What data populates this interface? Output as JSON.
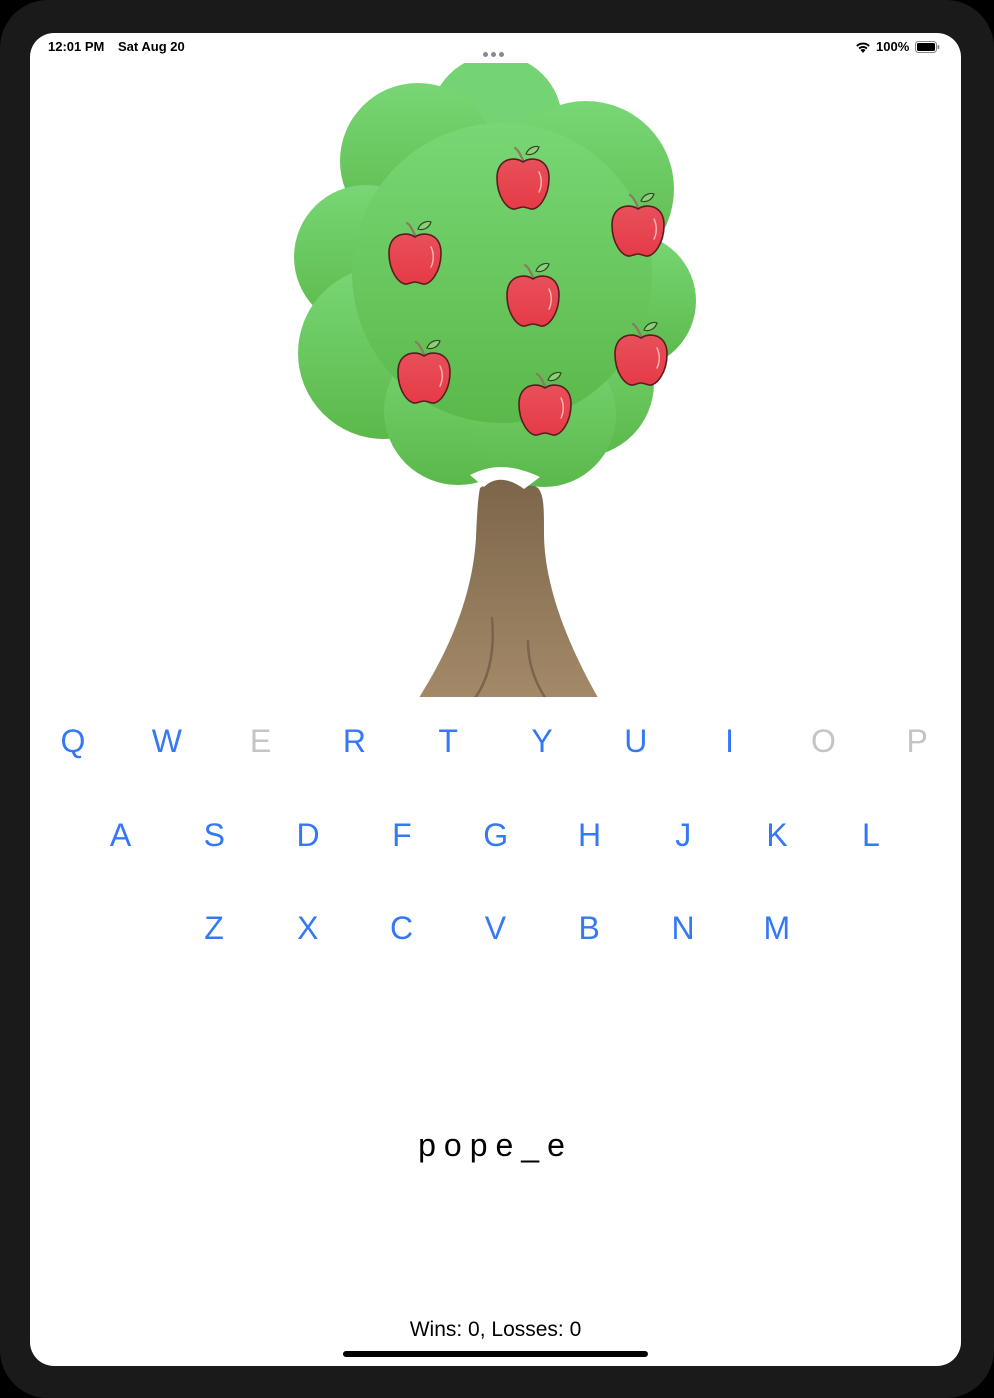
{
  "status_bar": {
    "time": "12:01 PM",
    "date": "Sat Aug 20",
    "battery_percent": "100%",
    "wifi_icon": "wifi-icon",
    "battery_icon": "battery-full-icon"
  },
  "tree": {
    "icon": "apple-tree",
    "apples_remaining": 7,
    "colors": {
      "foliage_top": "#78d775",
      "foliage_bottom": "#5bb84a",
      "trunk_top": "#7a6449",
      "trunk_bottom": "#a88e6c",
      "apple": "#e53b46"
    }
  },
  "keyboard": {
    "accent_color": "#3478f6",
    "disabled_color": "#c4c4c6",
    "rows": [
      [
        {
          "letter": "Q",
          "enabled": true
        },
        {
          "letter": "W",
          "enabled": true
        },
        {
          "letter": "E",
          "enabled": false
        },
        {
          "letter": "R",
          "enabled": true
        },
        {
          "letter": "T",
          "enabled": true
        },
        {
          "letter": "Y",
          "enabled": true
        },
        {
          "letter": "U",
          "enabled": true
        },
        {
          "letter": "I",
          "enabled": true
        },
        {
          "letter": "O",
          "enabled": false
        },
        {
          "letter": "P",
          "enabled": false
        }
      ],
      [
        {
          "letter": "A",
          "enabled": true
        },
        {
          "letter": "S",
          "enabled": true
        },
        {
          "letter": "D",
          "enabled": true
        },
        {
          "letter": "F",
          "enabled": true
        },
        {
          "letter": "G",
          "enabled": true
        },
        {
          "letter": "H",
          "enabled": true
        },
        {
          "letter": "J",
          "enabled": true
        },
        {
          "letter": "K",
          "enabled": true
        },
        {
          "letter": "L",
          "enabled": true
        }
      ],
      [
        {
          "letter": "Z",
          "enabled": true
        },
        {
          "letter": "X",
          "enabled": true
        },
        {
          "letter": "C",
          "enabled": true
        },
        {
          "letter": "V",
          "enabled": true
        },
        {
          "letter": "B",
          "enabled": true
        },
        {
          "letter": "N",
          "enabled": true
        },
        {
          "letter": "M",
          "enabled": true
        }
      ]
    ]
  },
  "game": {
    "word_display": "pope_e",
    "score_text": "Wins: 0, Losses: 0"
  }
}
